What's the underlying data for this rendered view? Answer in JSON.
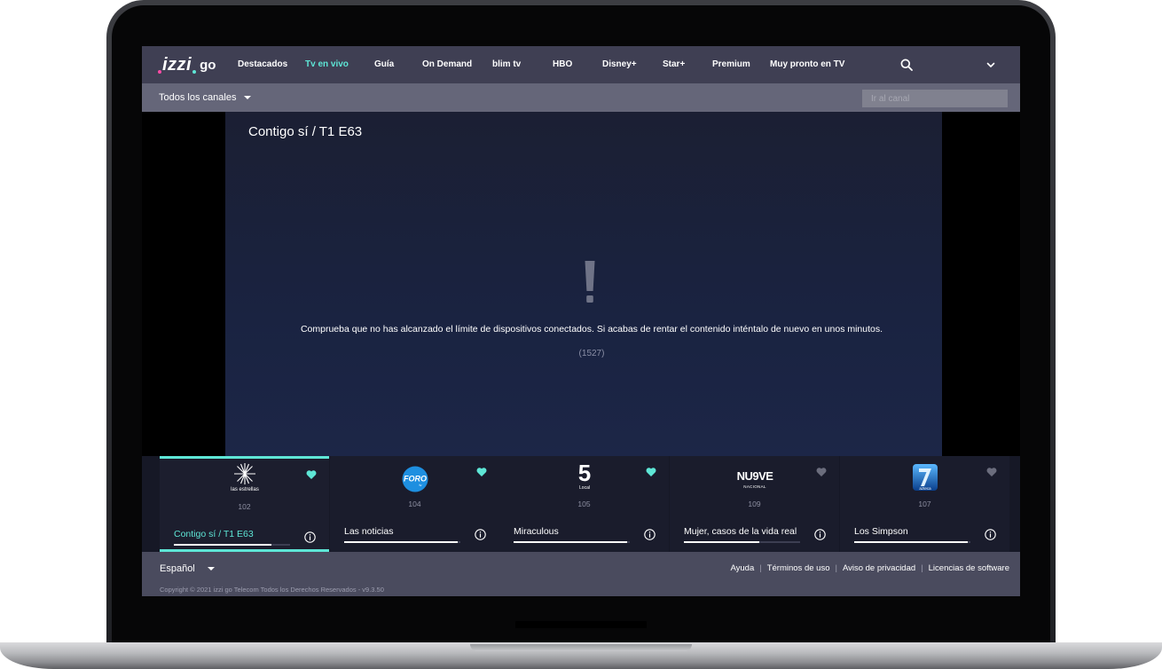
{
  "app": {
    "logo_text": "izzi",
    "logo_suffix": "go"
  },
  "nav": {
    "items": [
      {
        "label": "Destacados"
      },
      {
        "label": "Tv en vivo",
        "active": true
      },
      {
        "label": "Guía"
      },
      {
        "label": "On Demand"
      },
      {
        "label": "blim tv"
      },
      {
        "label": "HBO"
      },
      {
        "label": "Disney+"
      },
      {
        "label": "Star+"
      },
      {
        "label": "Premium"
      },
      {
        "label": "Muy pronto en TV"
      }
    ]
  },
  "subnav": {
    "filter_label": "Todos los canales",
    "channel_placeholder": "Ir al canal"
  },
  "player": {
    "title": "Contigo sí / T1 E63",
    "error_message": "Comprueba que no has alcanzado el límite de dispositivos conectados. Si acabas de rentar el contenido inténtalo de nuevo en unos minutos.",
    "error_code": "(1527)"
  },
  "channels": [
    {
      "number": "102",
      "logo": "las estrellas",
      "program": "Contigo sí / T1 E63",
      "progress": 0.84,
      "favorite": true,
      "active": true
    },
    {
      "number": "104",
      "logo": "FORO",
      "program": "Las noticias",
      "progress": 0.98,
      "favorite": true
    },
    {
      "number": "105",
      "logo": "5",
      "program": "Miraculous",
      "progress": 0.98,
      "favorite": true
    },
    {
      "number": "109",
      "logo": "NU9VE",
      "program": "Mujer, casos de la vida real",
      "progress": 0.65,
      "favorite": false
    },
    {
      "number": "107",
      "logo": "azteca 7",
      "program": "Los Simpson",
      "progress": 0.98,
      "favorite": false
    }
  ],
  "channel_logo_subtext": {
    "foro": "tv",
    "canal5": "Local",
    "nueve": "NACIONAL",
    "azteca": "azteca"
  },
  "footer": {
    "language": "Español",
    "links": [
      "Ayuda",
      "Términos de uso",
      "Aviso de privacidad",
      "Licencias de software"
    ],
    "copyright": "Copyright © 2021 izzi go Telecom Todos los Derechos Reservados - v9.3.50"
  },
  "colors": {
    "accent": "#5ee6d6",
    "topnav": "#3f3f53",
    "subnav": "#656679",
    "footer": "#4a4b5e"
  }
}
